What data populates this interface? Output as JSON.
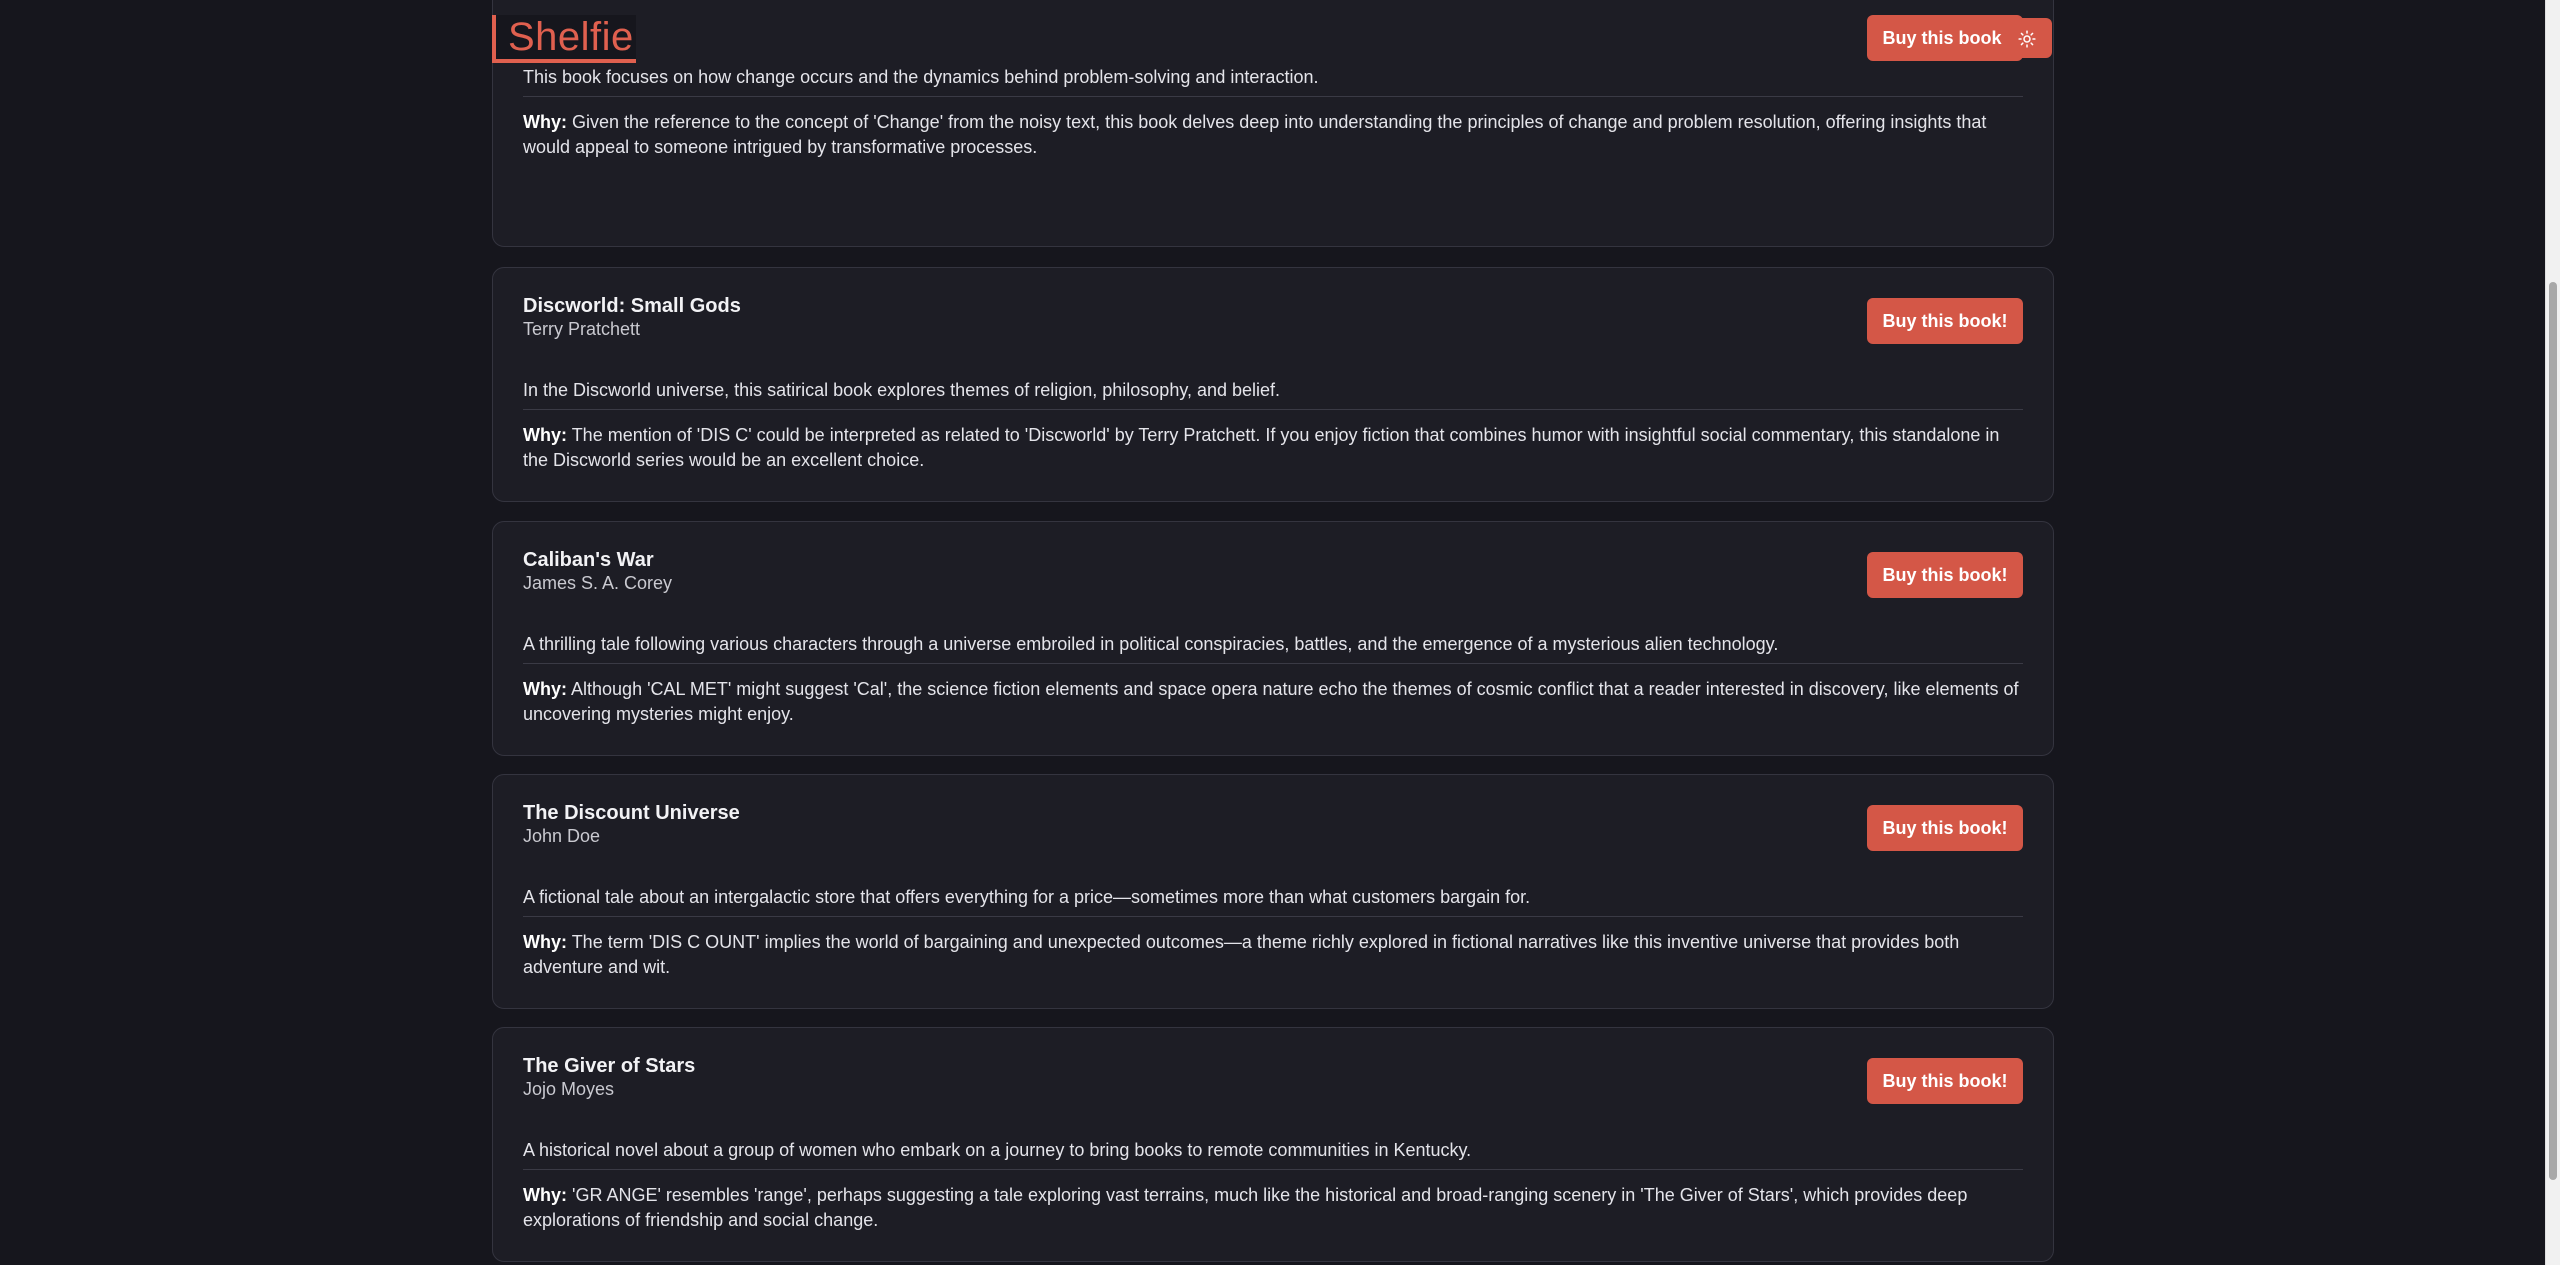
{
  "app": {
    "logo_text": "Shelfie",
    "theme_toggle_icon": "sun-icon"
  },
  "books": [
    {
      "title": "",
      "author": "",
      "buy_label": "Buy this book!",
      "description": "This book focuses on how change occurs and the dynamics behind problem-solving and interaction.",
      "why_label": "Why:",
      "why": "Given the reference to the concept of 'Change' from the noisy text, this book delves deep into understanding the principles of change and problem resolution, offering insights that would appeal to someone intrigued by transformative processes."
    },
    {
      "title": "Discworld: Small Gods",
      "author": "Terry Pratchett",
      "buy_label": "Buy this book!",
      "description": "In the Discworld universe, this satirical book explores themes of religion, philosophy, and belief.",
      "why_label": "Why:",
      "why": "The mention of 'DIS C' could be interpreted as related to 'Discworld' by Terry Pratchett. If you enjoy fiction that combines humor with insightful social commentary, this standalone in the Discworld series would be an excellent choice."
    },
    {
      "title": "Caliban's War",
      "author": "James S. A. Corey",
      "buy_label": "Buy this book!",
      "description": "A thrilling tale following various characters through a universe embroiled in political conspiracies, battles, and the emergence of a mysterious alien technology.",
      "why_label": "Why:",
      "why": "Although 'CAL MET' might suggest 'Cal', the science fiction elements and space opera nature echo the themes of cosmic conflict that a reader interested in discovery, like elements of uncovering mysteries might enjoy."
    },
    {
      "title": "The Discount Universe",
      "author": "John Doe",
      "buy_label": "Buy this book!",
      "description": "A fictional tale about an intergalactic store that offers everything for a price—sometimes more than what customers bargain for.",
      "why_label": "Why:",
      "why": "The term 'DIS C OUNT' implies the world of bargaining and unexpected outcomes—a theme richly explored in fictional narratives like this inventive universe that provides both adventure and wit."
    },
    {
      "title": "The Giver of Stars",
      "author": "Jojo Moyes",
      "buy_label": "Buy this book!",
      "description": "A historical novel about a group of women who embark on a journey to bring books to remote communities in Kentucky.",
      "why_label": "Why:",
      "why": "'GR ANGE' resembles 'range', perhaps suggesting a tale exploring vast terrains, much like the historical and broad-ranging scenery in 'The Giver of Stars', which provides deep explorations of friendship and social change."
    }
  ],
  "colors": {
    "background": "#16161d",
    "card": "#1d1d25",
    "accent": "#d45747",
    "logo": "#e0604f"
  }
}
